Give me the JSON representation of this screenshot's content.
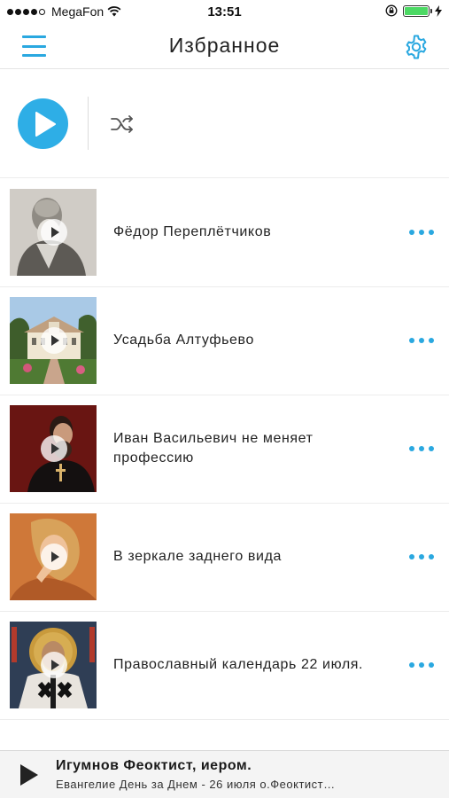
{
  "status_bar": {
    "carrier": "MegaFon",
    "time": "13:51",
    "signal_bars_filled": 4,
    "signal_bars_total": 5,
    "battery_level": 1.0,
    "icons": [
      "signal-icon",
      "wifi-icon",
      "orientation-lock-icon",
      "battery-icon",
      "charging-icon"
    ]
  },
  "header": {
    "title": "Избранное",
    "menu_icon": "hamburger-menu-icon",
    "settings_icon": "gear-icon"
  },
  "controls": {
    "play_icon": "play-icon",
    "shuffle_icon": "shuffle-icon"
  },
  "favorites": [
    {
      "title": "Фёдор Переплётчиков",
      "thumbnail": "portrait-photo-icon"
    },
    {
      "title": "Усадьба Алтуфьево",
      "thumbnail": "estate-photo-icon"
    },
    {
      "title": "Иван Васильевич не меняет профессию",
      "thumbnail": "priest-photo-icon"
    },
    {
      "title": "В зеркале заднего вида",
      "thumbnail": "woman-photo-icon"
    },
    {
      "title": "Православный календарь 22 июля.",
      "thumbnail": "icon-painting-icon"
    }
  ],
  "player": {
    "title": "Игумнов Феоктист, иером.",
    "subtitle": "Евангелие День за Днем - 26 июля о.Феоктист…"
  },
  "colors": {
    "accent": "#2aa8e0",
    "play_button": "#2eaee6",
    "divider": "#ececec",
    "player_background": "#f4f4f4"
  }
}
